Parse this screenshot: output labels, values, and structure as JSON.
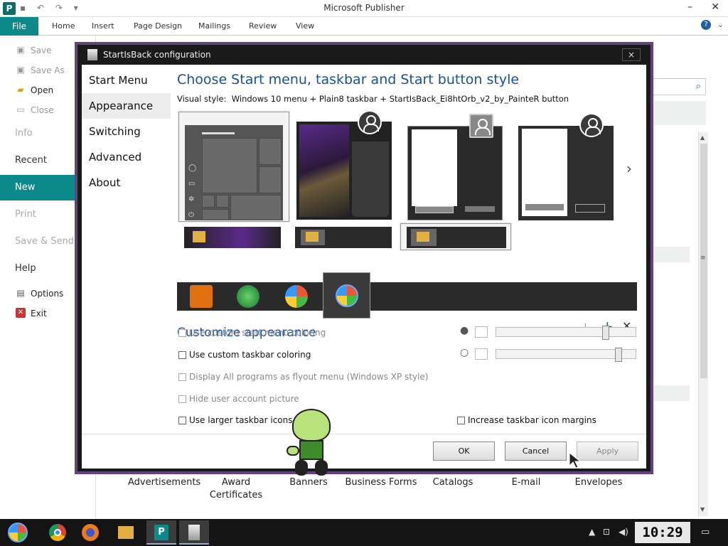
{
  "publisher": {
    "app_icon": "P",
    "window_title": "Microsoft Publisher",
    "ribbon": {
      "file_tab": "File",
      "tabs": [
        "Home",
        "Insert",
        "Page Design",
        "Mailings",
        "Review",
        "View"
      ],
      "help": "?"
    },
    "backstage": {
      "small_items": [
        {
          "label": "Save",
          "icon": "save-icon"
        },
        {
          "label": "Save As",
          "icon": "save-as-icon"
        },
        {
          "label": "Open",
          "icon": "open-folder-icon"
        },
        {
          "label": "Close",
          "icon": "close-doc-icon"
        }
      ],
      "info": "Info",
      "recent": "Recent",
      "new": "New",
      "print": "Print",
      "save_send": "Save & Send",
      "help": "Help",
      "options": "Options",
      "exit": "Exit"
    },
    "templates": [
      "Advertisements",
      "Award",
      "Certificates",
      "Banners",
      "Business Forms",
      "Catalogs",
      "E-mail",
      "Envelopes"
    ]
  },
  "dialog": {
    "title": "StartIsBack configuration",
    "close": "×",
    "nav": [
      "Start Menu",
      "Appearance",
      "Switching",
      "Advanced",
      "About"
    ],
    "active_nav": "Appearance",
    "heading_style": "Choose Start menu, taskbar and Start button style",
    "visual_style_label": "Visual style:",
    "visual_style_value": "Windows 10 menu + Plain8 taskbar + StartIsBack_Ei8htOrb_v2_by_PainteR button",
    "next_arrow": "›",
    "heading_customize": "Customize appearance",
    "toolbar_icons": [
      "download-icon",
      "add-icon",
      "remove-icon"
    ],
    "options": [
      {
        "label": "Use custom start menu coloring",
        "enabled": false
      },
      {
        "label": "Use custom taskbar coloring",
        "enabled": true
      },
      {
        "label": "Display All programs as flyout menu (Windows XP style)",
        "enabled": false
      },
      {
        "label": "Hide user account picture",
        "enabled": false
      },
      {
        "label": "Use larger taskbar icons",
        "enabled": true
      }
    ],
    "option_margins": "Increase taskbar icon margins",
    "slider_levels": [
      0.8,
      0.9
    ],
    "buttons": {
      "ok": "OK",
      "cancel": "Cancel",
      "apply": "Apply"
    }
  },
  "taskbar": {
    "clock": "10:29 AM",
    "apps": [
      "start-orb",
      "chrome-icon",
      "firefox-icon",
      "file-explorer-icon",
      "publisher-icon",
      "startisback-icon"
    ]
  }
}
